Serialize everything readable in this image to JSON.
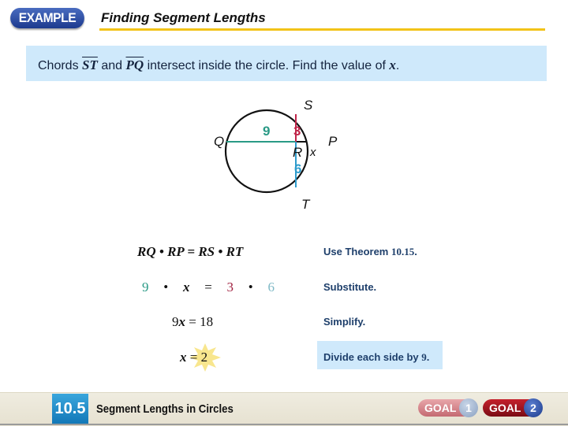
{
  "header": {
    "badge": "EXAMPLE",
    "title": "Finding Segment Lengths"
  },
  "problem": {
    "prefix": "Chords ",
    "chord1": "ST",
    "mid": " and ",
    "chord2": "PQ",
    "suffix": " intersect inside the circle.  Find the value of ",
    "var": "x",
    "end": "."
  },
  "diagram": {
    "labels": {
      "S": "S",
      "Q": "Q",
      "P": "P",
      "R": "R",
      "T": "T",
      "x": "x"
    },
    "segments": {
      "RQ": "9",
      "RS": "3",
      "RT": "6"
    },
    "colors": {
      "RQ": "#2a9a86",
      "RS": "#c0264a",
      "RT": "#2e9ccc",
      "RP": "#111111"
    }
  },
  "steps": [
    {
      "equation": "RQ • RP = RS • RT",
      "reason": "Use Theorem ",
      "reason_num": "10.15",
      "reason_end": "."
    },
    {
      "equation_parts": {
        "a": "9",
        "dot1": "•",
        "x": "x",
        "eq": "=",
        "b": "3",
        "dot2": "•",
        "c": "6"
      },
      "reason": "Substitute."
    },
    {
      "equation_coef": "9",
      "equation_var": "x",
      "equation_rest": " = 18",
      "reason": "Simplify."
    },
    {
      "equation_var": "x",
      "equation_rest": " = 2",
      "reason": "Divide each side by ",
      "reason_num": "9",
      "reason_end": "."
    }
  ],
  "footer": {
    "section_number": "10.5",
    "section_title": "Segment Lengths in Circles",
    "goal1_label": "GOAL",
    "goal1_num": "1",
    "goal2_label": "GOAL",
    "goal2_num": "2"
  }
}
